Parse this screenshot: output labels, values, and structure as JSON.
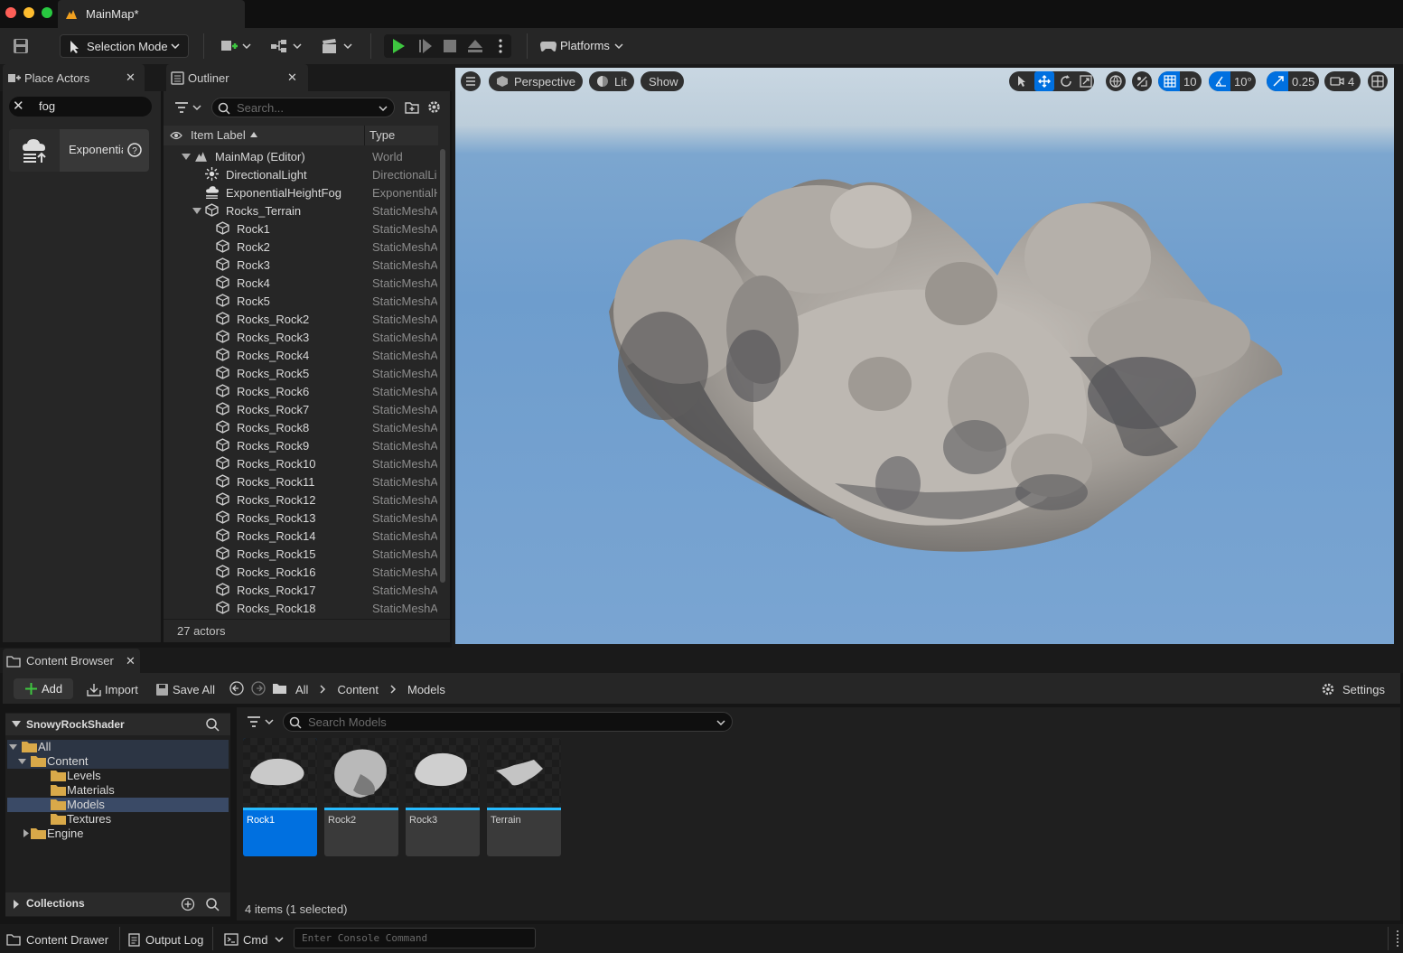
{
  "window": {
    "tab_title": "MainMap*"
  },
  "toolbar": {
    "selection_mode": "Selection Mode",
    "platforms": "Platforms"
  },
  "place_actors": {
    "tab": "Place Actors",
    "search_value": "fog",
    "results": [
      {
        "label": "ExponentialHeightFog",
        "icon": "fog-cloud-icon"
      }
    ]
  },
  "outliner": {
    "tab": "Outliner",
    "search_placeholder": "Search...",
    "col_label": "Item Label",
    "col_type": "Type",
    "rows": [
      {
        "label": "MainMap (Editor)",
        "type": "World",
        "depth": 0,
        "icon": "world-icon",
        "expanded": true
      },
      {
        "label": "DirectionalLight",
        "type": "DirectionalLight",
        "depth": 1,
        "icon": "light-icon"
      },
      {
        "label": "ExponentialHeightFog",
        "type": "ExponentialHeightFog",
        "depth": 1,
        "icon": "fog-icon"
      },
      {
        "label": "Rocks_Terrain",
        "type": "StaticMeshActor",
        "depth": 1,
        "icon": "static-mesh-icon",
        "expanded": true
      },
      {
        "label": "Rock1",
        "type": "StaticMeshActor",
        "depth": 2,
        "icon": "static-mesh-icon"
      },
      {
        "label": "Rock2",
        "type": "StaticMeshActor",
        "depth": 2,
        "icon": "static-mesh-icon"
      },
      {
        "label": "Rock3",
        "type": "StaticMeshActor",
        "depth": 2,
        "icon": "static-mesh-icon"
      },
      {
        "label": "Rock4",
        "type": "StaticMeshActor",
        "depth": 2,
        "icon": "static-mesh-icon"
      },
      {
        "label": "Rock5",
        "type": "StaticMeshActor",
        "depth": 2,
        "icon": "static-mesh-icon"
      },
      {
        "label": "Rocks_Rock2",
        "type": "StaticMeshActor",
        "depth": 2,
        "icon": "static-mesh-icon"
      },
      {
        "label": "Rocks_Rock3",
        "type": "StaticMeshActor",
        "depth": 2,
        "icon": "static-mesh-icon"
      },
      {
        "label": "Rocks_Rock4",
        "type": "StaticMeshActor",
        "depth": 2,
        "icon": "static-mesh-icon"
      },
      {
        "label": "Rocks_Rock5",
        "type": "StaticMeshActor",
        "depth": 2,
        "icon": "static-mesh-icon"
      },
      {
        "label": "Rocks_Rock6",
        "type": "StaticMeshActor",
        "depth": 2,
        "icon": "static-mesh-icon"
      },
      {
        "label": "Rocks_Rock7",
        "type": "StaticMeshActor",
        "depth": 2,
        "icon": "static-mesh-icon"
      },
      {
        "label": "Rocks_Rock8",
        "type": "StaticMeshActor",
        "depth": 2,
        "icon": "static-mesh-icon"
      },
      {
        "label": "Rocks_Rock9",
        "type": "StaticMeshActor",
        "depth": 2,
        "icon": "static-mesh-icon"
      },
      {
        "label": "Rocks_Rock10",
        "type": "StaticMeshActor",
        "depth": 2,
        "icon": "static-mesh-icon"
      },
      {
        "label": "Rocks_Rock11",
        "type": "StaticMeshActor",
        "depth": 2,
        "icon": "static-mesh-icon"
      },
      {
        "label": "Rocks_Rock12",
        "type": "StaticMeshActor",
        "depth": 2,
        "icon": "static-mesh-icon"
      },
      {
        "label": "Rocks_Rock13",
        "type": "StaticMeshActor",
        "depth": 2,
        "icon": "static-mesh-icon"
      },
      {
        "label": "Rocks_Rock14",
        "type": "StaticMeshActor",
        "depth": 2,
        "icon": "static-mesh-icon"
      },
      {
        "label": "Rocks_Rock15",
        "type": "StaticMeshActor",
        "depth": 2,
        "icon": "static-mesh-icon"
      },
      {
        "label": "Rocks_Rock16",
        "type": "StaticMeshActor",
        "depth": 2,
        "icon": "static-mesh-icon"
      },
      {
        "label": "Rocks_Rock17",
        "type": "StaticMeshActor",
        "depth": 2,
        "icon": "static-mesh-icon"
      },
      {
        "label": "Rocks_Rock18",
        "type": "StaticMeshActor",
        "depth": 2,
        "icon": "static-mesh-icon"
      }
    ],
    "footer": "27 actors"
  },
  "viewport": {
    "perspective": "Perspective",
    "lit": "Lit",
    "show": "Show",
    "grid_snap": "10",
    "rotation_snap": "10°",
    "scale_snap": "0.25",
    "camera_speed": "4"
  },
  "content_browser": {
    "tab": "Content Browser",
    "add": "Add",
    "import": "Import",
    "save_all": "Save All",
    "breadcrumb": [
      "All",
      "Content",
      "Models"
    ],
    "settings": "Settings",
    "source_title": "SnowyRockShader",
    "tree": [
      {
        "label": "All",
        "depth": 0,
        "open": true
      },
      {
        "label": "Content",
        "depth": 1,
        "open": true
      },
      {
        "label": "Levels",
        "depth": 2
      },
      {
        "label": "Materials",
        "depth": 2
      },
      {
        "label": "Models",
        "depth": 2,
        "selected": true
      },
      {
        "label": "Textures",
        "depth": 2
      },
      {
        "label": "Engine",
        "depth": 1,
        "collapsed": true
      }
    ],
    "collections": "Collections",
    "search_placeholder": "Search Models",
    "assets": [
      {
        "label": "Rock1",
        "selected": true
      },
      {
        "label": "Rock2"
      },
      {
        "label": "Rock3"
      },
      {
        "label": "Terrain"
      }
    ],
    "footer": "4 items (1 selected)"
  },
  "statusbar": {
    "content_drawer": "Content Drawer",
    "output_log": "Output Log",
    "cmd": "Cmd",
    "console_placeholder": "Enter Console Command"
  },
  "colors": {
    "accent": "#26bbff",
    "selection": "#0070e0",
    "play": "#3ec640",
    "sky": "#6e9dcd"
  }
}
